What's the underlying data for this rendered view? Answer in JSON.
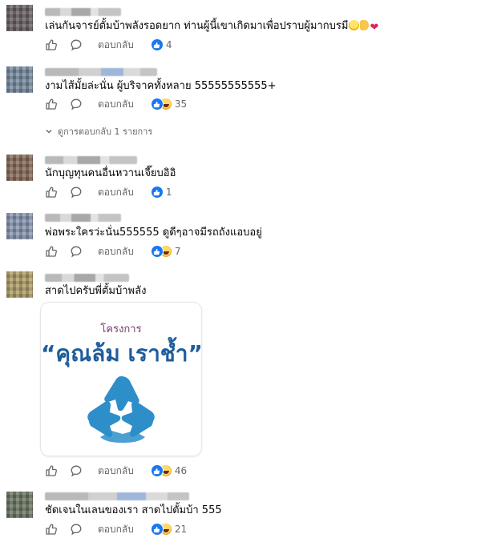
{
  "actions": {
    "reply_label": "ตอบกลับ"
  },
  "comments": [
    {
      "text": "เล่นกันจารย์ตั้มบ้าพลังรอดยาก ท่านผู้นี้เขาเกิดมาเพื่อปราบผู้มากบรมี",
      "reactions": [
        "like"
      ],
      "count": "4",
      "emojis": [
        "laughing-face-emoji",
        "thumbs-up-emoji",
        "red-heart-emoji"
      ]
    },
    {
      "text": "งามไส้มั้ยล่ะนั่น ผู้บริจาคทั้งหลาย 55555555555+",
      "reactions": [
        "like",
        "haha"
      ],
      "count": "35"
    },
    {
      "text": "นักบุญทุนคนอื่นหวานเจี๊ยบอิอิ",
      "reactions": [
        "like"
      ],
      "count": "1"
    },
    {
      "text": "พ่อพระใครว่ะนั่น555555 ดูดีๆอาจมีรถถังแอบอยู่",
      "reactions": [
        "like",
        "haha"
      ],
      "count": "7"
    },
    {
      "text": "สาดไปครับพี่ตั้มบ้าพลัง",
      "reactions": [
        "like",
        "haha"
      ],
      "count": "46",
      "image": {
        "kicker": "โครงการ",
        "title": "“คุณล้ม เราช้ำ”"
      }
    },
    {
      "text": "ชัดเจนในเลนของเรา สาดไปตั้มบ้า 555",
      "reactions": [
        "like",
        "haha"
      ],
      "count": "21"
    }
  ],
  "view_replies": "ดูการตอบกลับ 1 รายการ",
  "colors": {
    "like_blue": "#1877f2",
    "meta_gray": "#65676b",
    "image_title_blue": "#1e5d9b",
    "image_kicker_purple": "#7b3a72",
    "hands_blue": "#2d8ec9"
  }
}
